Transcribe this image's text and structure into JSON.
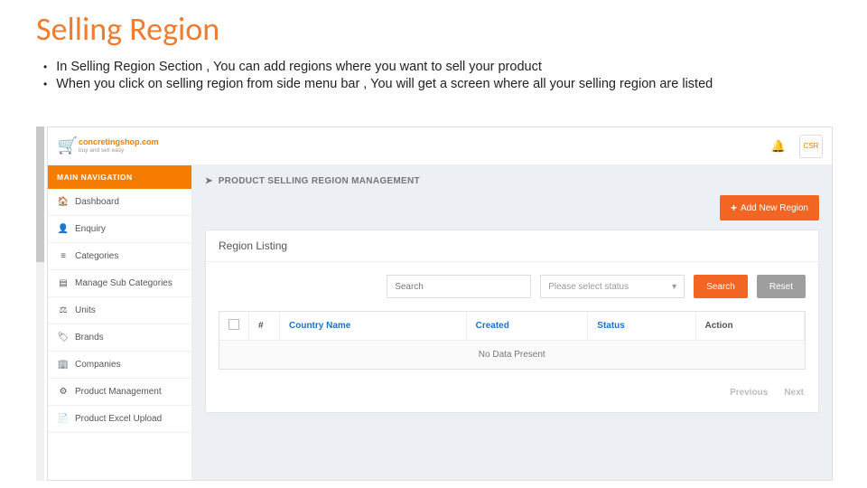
{
  "slide": {
    "title": "Selling Region",
    "bullets": [
      "In Selling Region Section , You can add regions where you want to sell your product",
      "When you click on selling region from side menu bar , You will get a screen where all your selling region are listed"
    ]
  },
  "header": {
    "brand_top": "concretingshop.com",
    "brand_sub": "buy and sell easy",
    "avatar": "CSR"
  },
  "sidebar": {
    "header": "MAIN NAVIGATION",
    "items": [
      {
        "label": "Dashboard",
        "icon": "🏠"
      },
      {
        "label": "Enquiry",
        "icon": "👤"
      },
      {
        "label": "Categories",
        "icon": "≡"
      },
      {
        "label": "Manage Sub Categories",
        "icon": "▤"
      },
      {
        "label": "Units",
        "icon": "⚖"
      },
      {
        "label": "Brands",
        "icon": "🏷"
      },
      {
        "label": "Companies",
        "icon": "🏢"
      },
      {
        "label": "Product Management",
        "icon": "⚙"
      },
      {
        "label": "Product Excel Upload",
        "icon": "📄"
      }
    ]
  },
  "main": {
    "page_title": "PRODUCT SELLING REGION MANAGEMENT",
    "page_icon": "➤",
    "add_btn": "Add New Region",
    "card_title": "Region Listing",
    "search_placeholder": "Search",
    "status_placeholder": "Please select status",
    "search_btn": "Search",
    "reset_btn": "Reset",
    "columns": {
      "num": "#",
      "country": "Country Name",
      "created": "Created",
      "status": "Status",
      "action": "Action"
    },
    "empty": "No Data Present",
    "previous": "Previous",
    "next": "Next"
  }
}
